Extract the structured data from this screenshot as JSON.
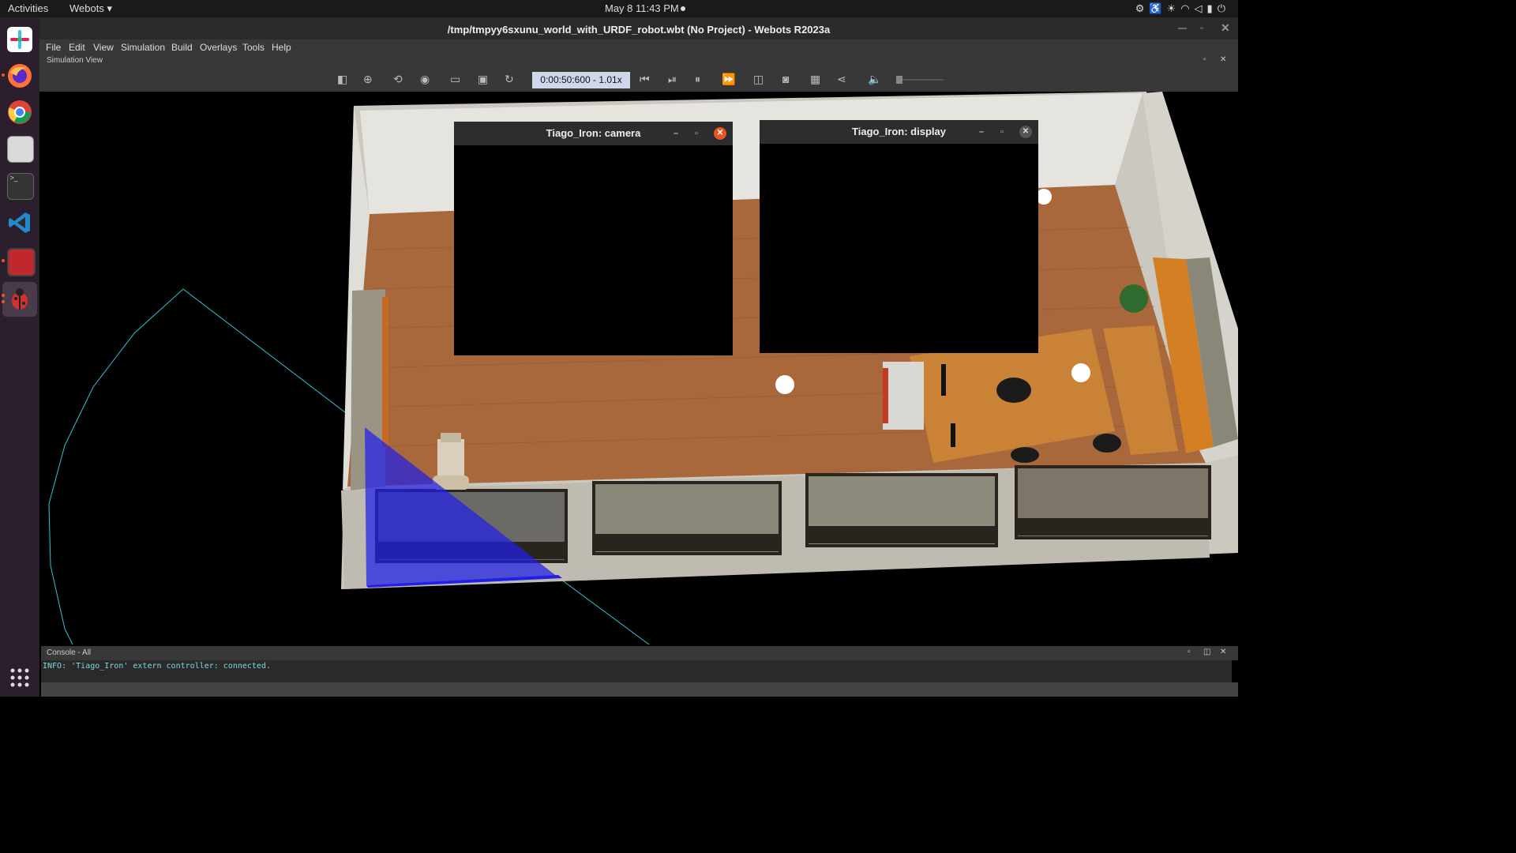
{
  "topbar": {
    "activities": "Activities",
    "app_menu": "Webots",
    "clock": "May 8  11:43 PM"
  },
  "window": {
    "title": "/tmp/tmpyy6sxunu_world_with_URDF_robot.wbt (No Project) - Webots R2023a"
  },
  "menu": [
    "File",
    "Edit",
    "View",
    "Simulation",
    "Build",
    "Overlays",
    "Tools",
    "Help"
  ],
  "simulation_view": {
    "label": "Simulation View",
    "time": "0:00:50:600  -  1.01x",
    "volume": 0
  },
  "popups": {
    "camera_title": "Tiago_Iron: camera",
    "display_title": "Tiago_Iron: display"
  },
  "console": {
    "label": "Console - All",
    "line": "INFO: 'Tiago_Iron' extern controller: connected."
  },
  "colors": {
    "close_active": "#e95420",
    "console_text": "#7fd6e6",
    "time_box": "#cfd8e8",
    "floor": "#a8683c",
    "wall": "#d8d6cf",
    "lidar": "#2020e8",
    "frustum": "#2ec4d6"
  },
  "dock_icons": [
    "slack-icon",
    "firefox-icon",
    "chrome-icon",
    "files-icon",
    "terminal-icon",
    "vscode-icon",
    "webots-red-icon",
    "webots-bug-icon",
    "app-grid-icon"
  ]
}
